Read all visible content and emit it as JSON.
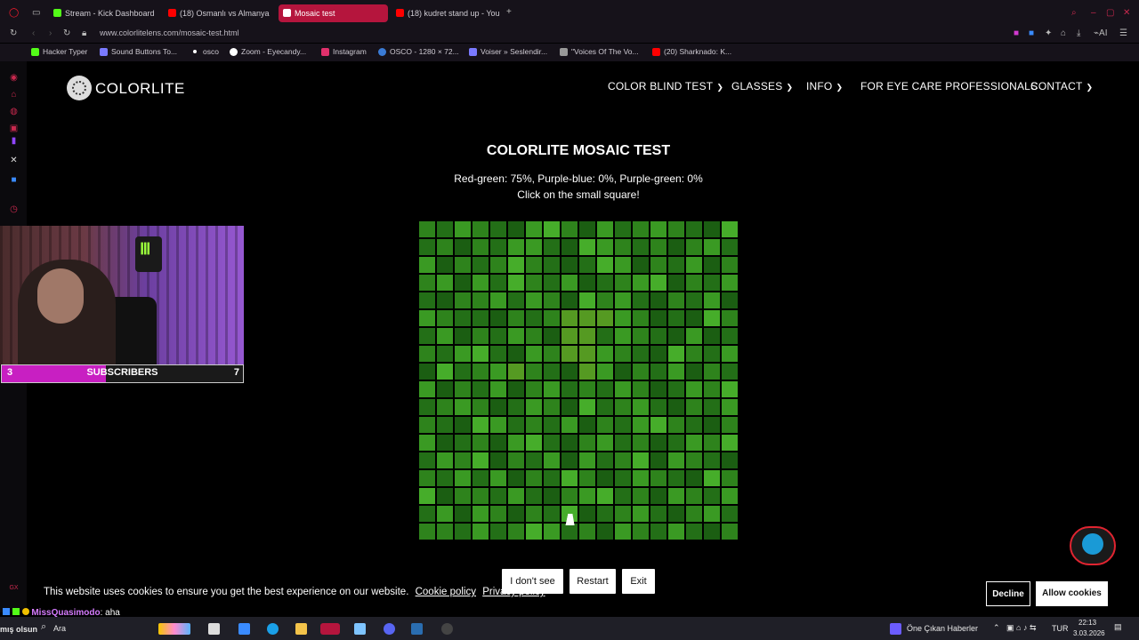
{
  "browser": {
    "tabs": [
      {
        "label": "Stream - Kick Dashboard",
        "color": "#53fc18"
      },
      {
        "label": "(18) Osmanlı vs Almanya",
        "color": "#ff0000"
      },
      {
        "label": "Mosaic test",
        "color": "#ffffff"
      },
      {
        "label": "(18) kudret stand up - You",
        "color": "#ff0000"
      }
    ],
    "new_tab": "+",
    "url": "www.colorlitelens.com/mosaic-test.html",
    "bookmarks": [
      {
        "label": "Hacker Typer",
        "color": "#53fc18"
      },
      {
        "label": "Sound Buttons To...",
        "color": "#7a7aff"
      },
      {
        "label": "osco",
        "color": "#ffffff"
      },
      {
        "label": "Zoom - Eyecandy...",
        "color": "#ffffff"
      },
      {
        "label": "Instagram",
        "color": "#e1306c"
      },
      {
        "label": "OSCO - 1280 × 72...",
        "color": "#3a7bd5"
      },
      {
        "label": "Voiser » Seslendir...",
        "color": "#7a7aff"
      },
      {
        "label": "\"Voices Of The Vo...",
        "color": "#999999"
      },
      {
        "label": "(20) Sharknado: K...",
        "color": "#ff0000"
      }
    ]
  },
  "site": {
    "logo": "COLORLITE",
    "nav": [
      "COLOR BLIND TEST",
      "GLASSES",
      "INFO",
      "FOR EYE CARE PROFESSIONALS",
      "CONTACT"
    ],
    "title": "COLORLITE MOSAIC TEST",
    "scores": "Red-green: 75%, Purple-blue: 0%, Purple-green: 0%",
    "instruction": "Click on the small square!",
    "buttons": {
      "dont_see": "I don't see",
      "restart": "Restart",
      "exit": "Exit"
    }
  },
  "mosaic": {
    "rows": 18,
    "cols": 18,
    "palette": [
      "#1b5e12",
      "#236f17",
      "#2e831c",
      "#3a9a23",
      "#46ad2a",
      "#559a22"
    ],
    "cells": [
      "213210342031232104",
      "120213310432120231",
      "302124210143021302",
      "230314213012340213",
      "102231320423102130",
      "321102125553201042",
      "130213205513210301",
      "213410325532104213",
      "041235210530213021",
      "302130231213201324",
      "123201320412310213",
      "210431213021342102",
      "301203410231201324",
      "132402130312403210",
      "213130214201321042",
      "402213102341203213",
      "130320214012310231",
      "221312431203213102"
    ]
  },
  "cookie": {
    "text": "This website uses cookies to ensure you get the best experience on our website.",
    "policy": "Cookie policy",
    "privacy": "Privacy policy",
    "decline": "Decline",
    "allow": "Allow cookies"
  },
  "overlay": {
    "sub_left": "3",
    "sub_label": "SUBSCRIBERS",
    "sub_right": "7",
    "sub_progress": 0.43,
    "chat_user": "MissQuasimodo",
    "chat_msg": ": aha",
    "chat_prefix": "mış olsun"
  },
  "taskbar": {
    "search": "Ara",
    "news": "Öne Çıkan Haberler",
    "lang": "TUR",
    "time": "22:13",
    "date": "3.03.2026"
  }
}
